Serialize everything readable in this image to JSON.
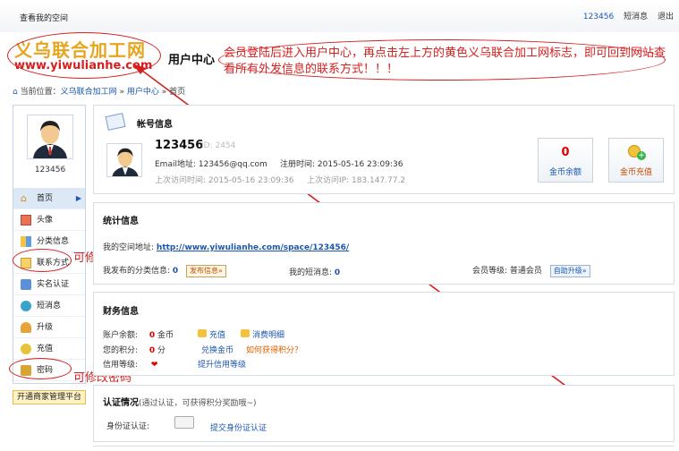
{
  "topbar": {
    "my_space": "查看我的空间",
    "username": "123456",
    "messages": "短消息",
    "logout": "退出"
  },
  "logo": {
    "cn": "义乌联合加工网",
    "url": "www.yiwulianhe.com"
  },
  "header": {
    "title": "用户中心"
  },
  "annotations": {
    "main": "会员登陆后进入用户中心，再点击左上方的黄色义乌联合加工网标志，即可回到网站查看所有外发信息的联系方式！！！",
    "contact": "可修改联系方式",
    "password": "可修改密码"
  },
  "breadcrumb": {
    "prefix": "当前位置：",
    "site": "义乌联合加工网",
    "sep1": " » ",
    "uc": "用户中心",
    "sep2": " » ",
    "current": "首页"
  },
  "sidebar": {
    "username": "123456",
    "items": [
      {
        "label": "首页",
        "icon": "home-icon"
      },
      {
        "label": "头像",
        "icon": "portrait-icon"
      },
      {
        "label": "分类信息",
        "icon": "category-icon"
      },
      {
        "label": "联系方式",
        "icon": "contact-card-icon"
      },
      {
        "label": "实名认证",
        "icon": "verify-icon"
      },
      {
        "label": "短消息",
        "icon": "message-icon"
      },
      {
        "label": "升级",
        "icon": "upgrade-icon"
      },
      {
        "label": "充值",
        "icon": "recharge-icon"
      },
      {
        "label": "密码",
        "icon": "lock-icon"
      }
    ],
    "merchant_button": "开通商家管理平台"
  },
  "account": {
    "title": "帐号信息",
    "name": "123456",
    "id": "ID: 2454",
    "email_label": "Email地址: ",
    "email": "123456@qq.com",
    "reg_label": "注册时间: ",
    "reg_time": "2015-05-16 23:09:36",
    "last_visit_label": "上次访问时间: ",
    "last_visit": "2015-05-16 23:09:36",
    "last_ip_label": "上次访问IP: ",
    "last_ip": "183.147.77.2",
    "balance_value": "0",
    "balance_label": "金币余额",
    "recharge_label": "金币充值"
  },
  "stats": {
    "title": "统计信息",
    "space_label": "我的空间地址: ",
    "space_url": "http://www.yiwulianhe.com/space/123456/",
    "posted_label": "我发布的分类信息: ",
    "posted_count": "0",
    "post_button": "发布信息»",
    "sms_label": "我的短消息: ",
    "sms_count": "0",
    "level_label": "会员等级: ",
    "level_value": "普通会员",
    "upgrade_button": "自助升级»"
  },
  "finance": {
    "title": "财务信息",
    "balance_label": "账户余额: ",
    "balance_value": "0",
    "balance_unit": " 金币",
    "recharge": "充值",
    "details": "消费明细",
    "points_label": "您的积分: ",
    "points_value": "0",
    "points_unit": " 分",
    "exchange": "兑换金币",
    "how_points": "如何获得积分？",
    "credit_label": "信用等级: ",
    "credit_upgrade": "提升信用等级"
  },
  "certify": {
    "title": "认证情况",
    "subtitle": "(通过认证，可获得积分奖励哦~)",
    "id_label": "身份证认证:",
    "id_action": "提交身份证认证"
  },
  "colors": {
    "accent": "#1a57b0",
    "annotation": "#d62020",
    "logo": "#e6a51e"
  }
}
